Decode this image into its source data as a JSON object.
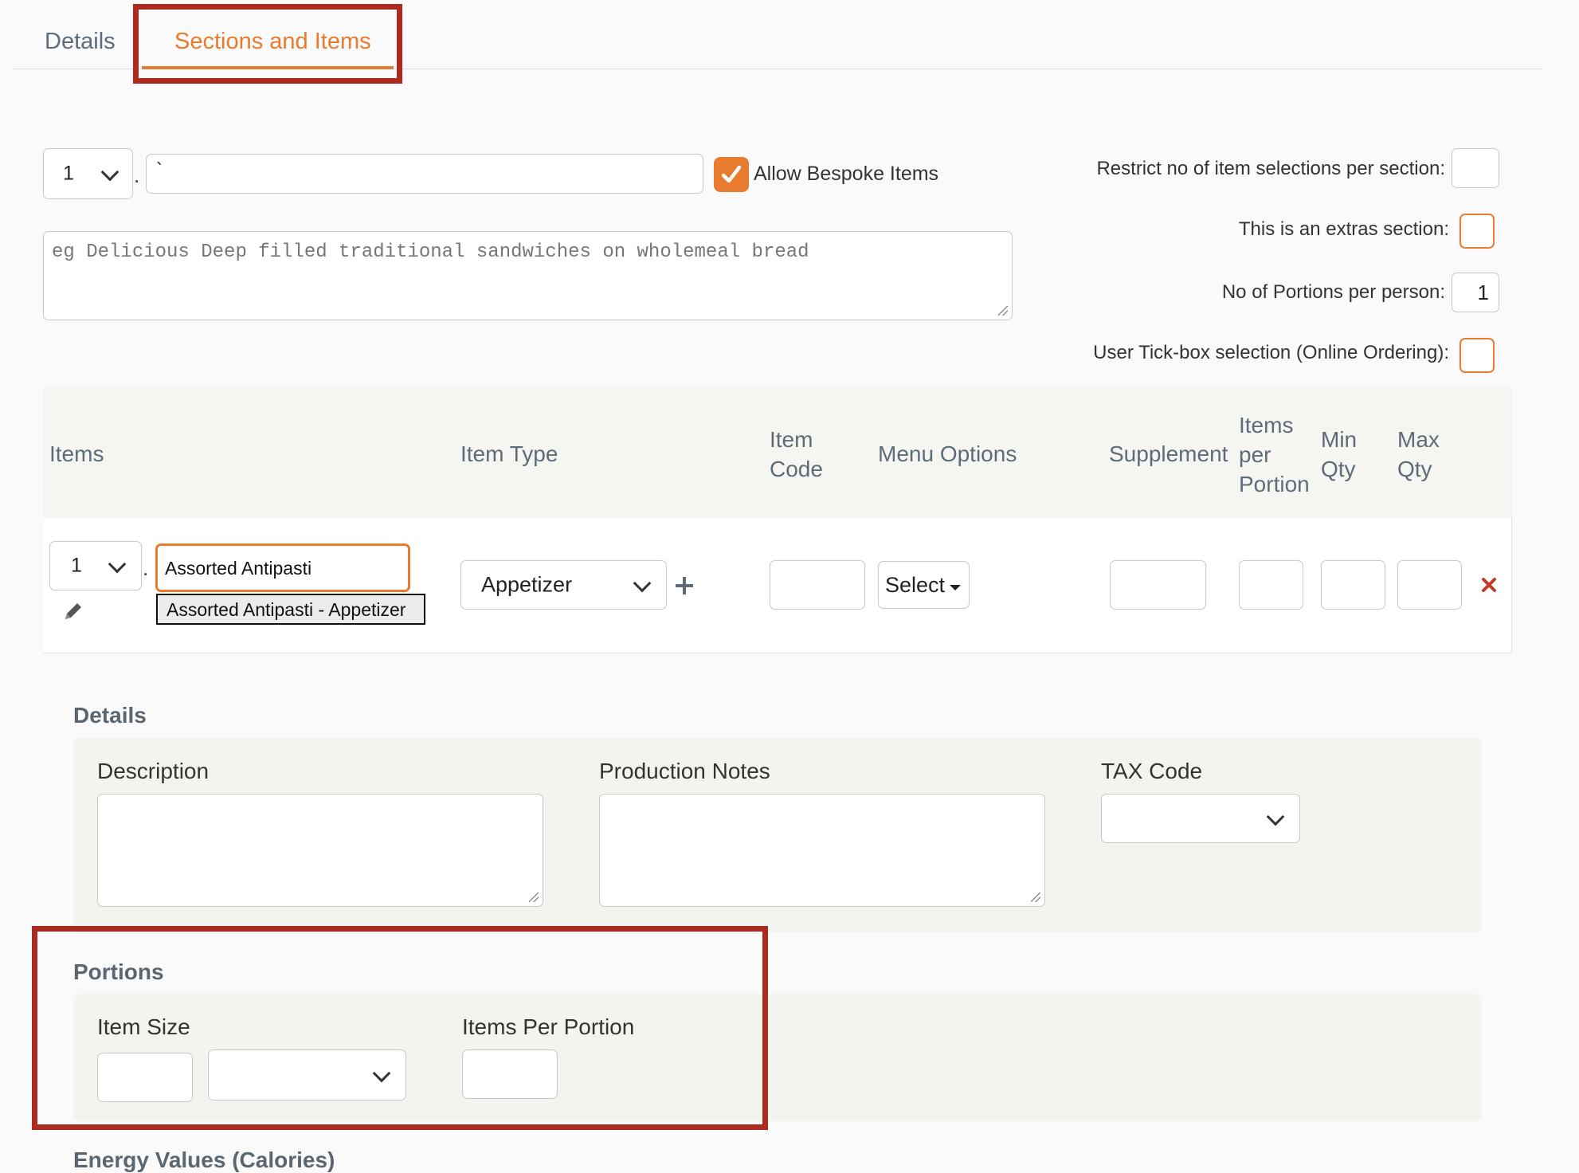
{
  "tabs": [
    {
      "label": "Details",
      "active": false
    },
    {
      "label": "Sections and Items",
      "active": true
    }
  ],
  "section": {
    "number": "1",
    "separator": ".",
    "name_value": "`",
    "allow_bespoke_label": "Allow Bespoke Items",
    "allow_bespoke_checked": true,
    "description_placeholder": "eg Delicious Deep filled traditional sandwiches on wholemeal bread",
    "restrict_label": "Restrict no of item selections per section:",
    "restrict_value": "",
    "extras_label": "This is an extras section:",
    "portions_per_person_label": "No of Portions per person:",
    "portions_per_person_value": "1",
    "user_tickbox_label": "User Tick-box selection (Online Ordering):"
  },
  "items_table": {
    "headers": {
      "items": "Items",
      "item_type": "Item Type",
      "item_code": "Item Code",
      "menu_options": "Menu Options",
      "supplement": "Supplement",
      "items_per_portion": "Items per Portion",
      "min_qty": "Min Qty",
      "max_qty": "Max Qty"
    },
    "row": {
      "number": "1",
      "separator": ".",
      "item_name": "Assorted Antipasti",
      "autocomplete_suggestion": "Assorted Antipasti - Appetizer",
      "item_type": "Appetizer",
      "item_code": "",
      "menu_options_button": "Select",
      "supplement": "",
      "items_per_portion": "",
      "min_qty": "",
      "max_qty": ""
    }
  },
  "details": {
    "title": "Details",
    "description_label": "Description",
    "production_notes_label": "Production Notes",
    "tax_code_label": "TAX Code",
    "tax_code_value": ""
  },
  "portions": {
    "title": "Portions",
    "item_size_label": "Item Size",
    "item_size_value": "",
    "item_size_unit": "",
    "items_per_portion_label": "Items Per Portion",
    "items_per_portion_value": ""
  },
  "energy": {
    "title": "Energy Values (Calories)"
  },
  "colors": {
    "accent": "#e87b2e",
    "annotation": "#ad2a1e",
    "delete": "#c0392b"
  }
}
